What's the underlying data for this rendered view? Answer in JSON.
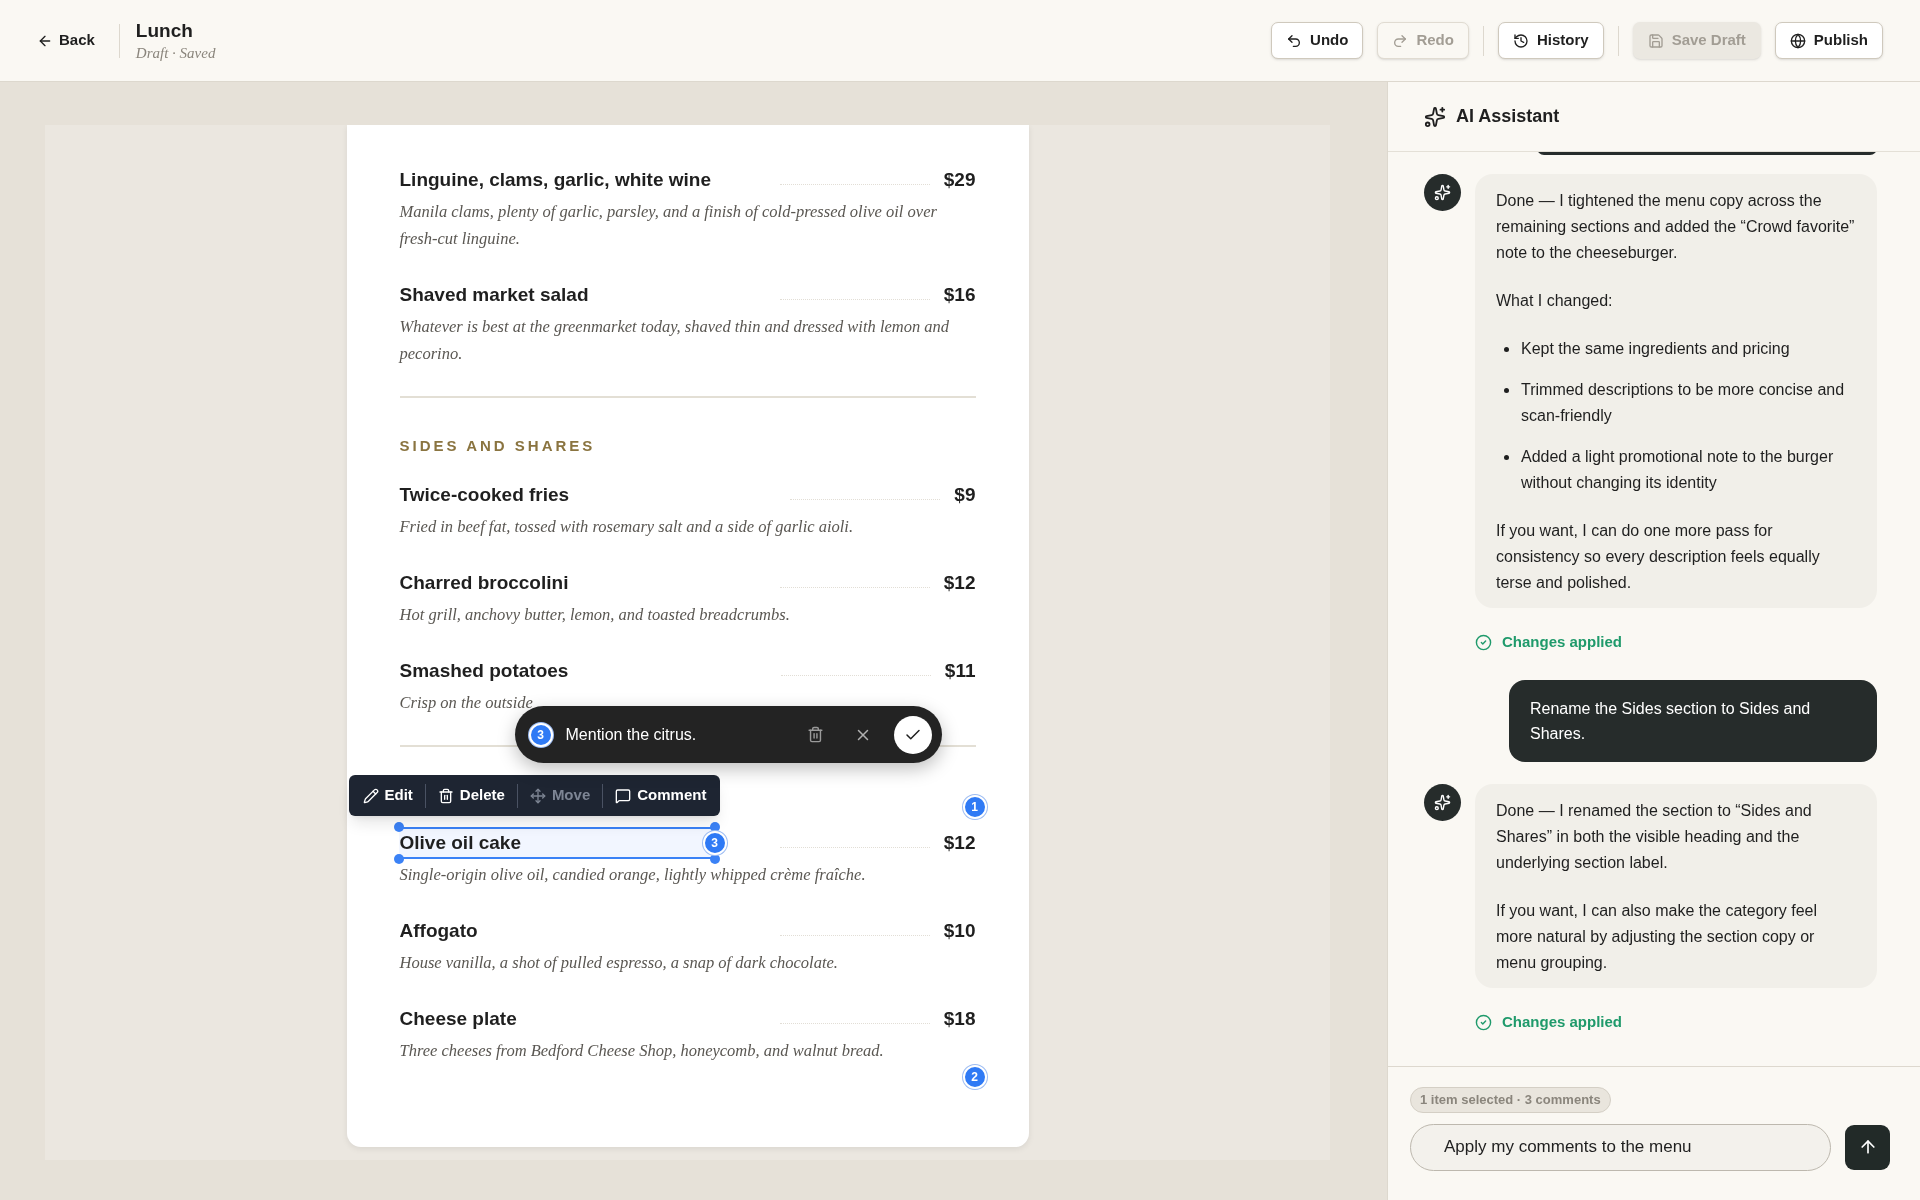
{
  "topbar": {
    "back": "Back",
    "title": "Lunch",
    "subtitle": "Draft · Saved",
    "actions": [
      {
        "label": "Undo",
        "kind": "undo",
        "disabled": false,
        "separator_before": false
      },
      {
        "label": "Redo",
        "kind": "redo",
        "disabled": true,
        "separator_before": false
      },
      {
        "label": "History",
        "kind": "history",
        "disabled": false,
        "separator_before": true
      },
      {
        "label": "Save Draft",
        "kind": "save",
        "disabled": true,
        "separator_before": true
      },
      {
        "label": "Publish",
        "kind": "publish",
        "disabled": false,
        "separator_before": false
      }
    ]
  },
  "menu": {
    "groups": [
      {
        "items": [
          {
            "name": "Linguine, clams, garlic, white wine",
            "price": "$29",
            "description": "Manila clams, plenty of garlic, parsley, and a finish of cold-pressed olive oil over fresh-cut linguine.",
            "selected": false
          },
          {
            "name": "Shaved market salad",
            "price": "$16",
            "description": "Whatever is best at the greenmarket today, shaved thin and dressed with lemon and pecorino.",
            "selected": false
          }
        ]
      },
      {
        "heading": "SIDES AND SHARES",
        "items": [
          {
            "name": "Twice-cooked fries",
            "price": "$9",
            "description": "Fried in beef fat, tossed with rosemary salt and a side of garlic aioli.",
            "selected": false
          },
          {
            "name": "Charred broccolini",
            "price": "$12",
            "description": "Hot grill, anchovy butter, lemon, and toasted breadcrumbs.",
            "selected": false
          },
          {
            "name": "Smashed potatoes",
            "price": "$11",
            "description": "Crisp on the outside",
            "selected": false
          }
        ]
      },
      {
        "items": [
          {
            "name": "Olive oil cake",
            "price": "$12",
            "description": "Single-origin olive oil, candied orange, lightly whipped crème fraîche.",
            "selected": true,
            "comments": [
              {
                "number": "1",
                "kind": "above"
              },
              {
                "number": "3",
                "kind": "inline"
              }
            ]
          },
          {
            "name": "Affogato",
            "price": "$10",
            "description": "House vanilla, a shot of pulled espresso, a snap of dark chocolate.",
            "selected": false
          },
          {
            "name": "Cheese plate",
            "price": "$18",
            "description": "Three cheeses from Bedford Cheese Shop, honeycomb, and walnut bread.",
            "selected": false,
            "comments": [
              {
                "number": "2",
                "kind": "below"
              }
            ]
          }
        ]
      }
    ]
  },
  "toolbar": [
    {
      "label": "Edit",
      "kind": "edit",
      "disabled": false
    },
    {
      "label": "Delete",
      "kind": "delete",
      "disabled": false
    },
    {
      "label": "Move",
      "kind": "move",
      "disabled": true
    },
    {
      "label": "Comment",
      "kind": "comment",
      "disabled": false
    }
  ],
  "comment_popover": {
    "number": "3",
    "text": "Mention the citrus."
  },
  "assistant": {
    "title": "AI Assistant",
    "messages": [
      {
        "kind": "assistant",
        "blocks": [
          {
            "kind": "paragraph",
            "text": "Done — I tightened the menu copy across the remaining sections and added the “Crowd favorite” note to the cheeseburger."
          },
          {
            "kind": "paragraph",
            "text": "What I changed:"
          },
          {
            "kind": "list",
            "items": [
              "Kept the same ingredients and pricing",
              "Trimmed descriptions to be more concise and scan-friendly",
              "Added a light promotional note to the burger without changing its identity"
            ]
          },
          {
            "kind": "paragraph",
            "text": "If you want, I can do one more pass for consistency so every description feels equally terse and polished."
          }
        ],
        "status": "Changes applied"
      },
      {
        "kind": "user",
        "text": "Rename the Sides section to Sides and Shares."
      },
      {
        "kind": "assistant",
        "blocks": [
          {
            "kind": "paragraph",
            "text": "Done — I renamed the section to “Sides and Shares” in both the visible heading and the underlying section label."
          },
          {
            "kind": "paragraph",
            "text": "If you want, I can also make the category feel more natural by adjusting the section copy or menu grouping."
          }
        ],
        "status": "Changes applied"
      }
    ],
    "selection_badge": "1 item selected · 3 comments",
    "input_value": "Apply my comments to the menu"
  }
}
